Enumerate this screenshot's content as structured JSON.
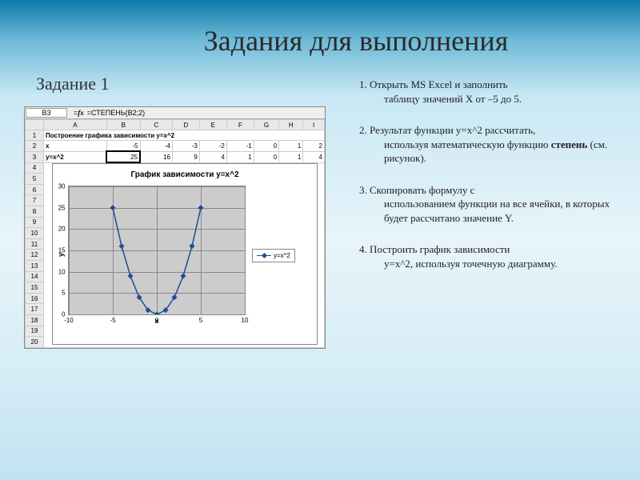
{
  "title": "Задания для выполнения",
  "subtitle": "Задание 1",
  "formula_bar": {
    "cell": "B3",
    "prefix": "=",
    "formula": "=СТЕПЕНЬ(B2;2)"
  },
  "sheet": {
    "cols": [
      "A",
      "B",
      "C",
      "D",
      "E",
      "F",
      "G",
      "H",
      "I"
    ],
    "row1_label": "Построение графика зависимости y=x^2",
    "row2": {
      "label": "x",
      "vals": [
        "-5",
        "-4",
        "-3",
        "-2",
        "-1",
        "0",
        "1",
        "2"
      ]
    },
    "row3": {
      "label": "y=x^2",
      "vals": [
        "25",
        "16",
        "9",
        "4",
        "1",
        "0",
        "1",
        "4"
      ]
    }
  },
  "chart": {
    "title": "График зависимости y=x^2",
    "ylabel": "y",
    "xlabel": "x",
    "legend": "y=x^2",
    "yticks": [
      "30",
      "25",
      "20",
      "15",
      "10",
      "5",
      "0"
    ],
    "xticks": [
      "-10",
      "-5",
      "0",
      "5",
      "10"
    ]
  },
  "chart_data": {
    "type": "scatter",
    "title": "График зависимости y=x^2",
    "xlabel": "x",
    "ylabel": "y",
    "xlim": [
      -10,
      10
    ],
    "ylim": [
      0,
      30
    ],
    "series": [
      {
        "name": "y=x^2",
        "x": [
          -5,
          -4,
          -3,
          -2,
          -1,
          0,
          1,
          2,
          3,
          4,
          5
        ],
        "y": [
          25,
          16,
          9,
          4,
          1,
          0,
          1,
          4,
          9,
          16,
          25
        ]
      }
    ]
  },
  "steps": [
    {
      "t": "Открыть MS Excel и заполнить",
      "i": "таблицу значений X от –5 до 5."
    },
    {
      "t": "Результат функции y=x^2 рассчитать,",
      "i": "используя математическую функцию <b>степень</b> (см. рисунок)."
    },
    {
      "t": "Скопировать формулу с",
      "i": "использованием функции на все ячейки, в которых будет рассчитано значение Y."
    },
    {
      "t": "Построить график зависимости",
      "i": "y=x^2, используя точечную диаграмму."
    }
  ]
}
